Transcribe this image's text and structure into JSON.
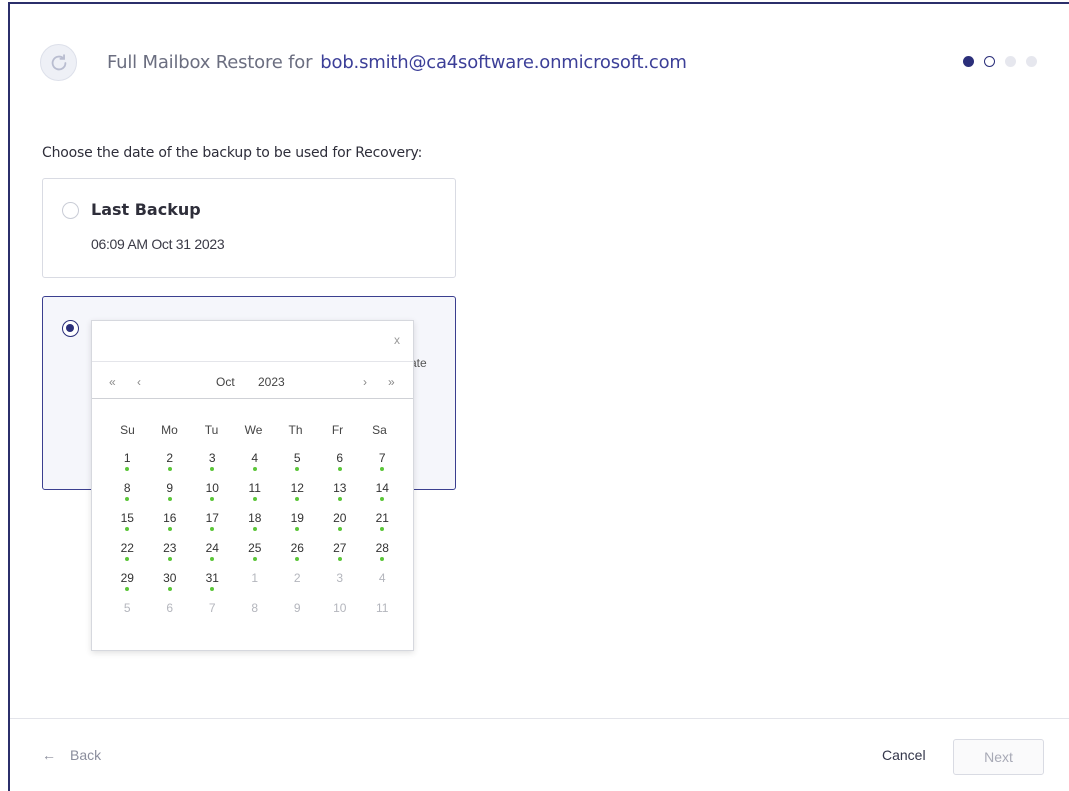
{
  "header": {
    "icon": "restore-icon",
    "title": "Full Mailbox Restore for",
    "email": "bob.smith@ca4software.onmicrosoft.com",
    "steps": [
      "active",
      "current",
      "pending",
      "pending"
    ]
  },
  "prompt": "Choose the date of the backup to be used for Recovery:",
  "options": {
    "last_backup": {
      "title": "Last Backup",
      "datetime": "06:09 AM Oct 31 2023",
      "selected": false
    },
    "custom_date": {
      "selected": true,
      "partial_text": "ate"
    }
  },
  "datepicker": {
    "close": "x",
    "prev_year": "«",
    "prev_month": "‹",
    "month": "Oct",
    "year": "2023",
    "next_month": "›",
    "next_year": "»",
    "weekdays": [
      "Su",
      "Mo",
      "Tu",
      "We",
      "Th",
      "Fr",
      "Sa"
    ],
    "days": [
      {
        "d": "1",
        "muted": false,
        "backup": true
      },
      {
        "d": "2",
        "muted": false,
        "backup": true
      },
      {
        "d": "3",
        "muted": false,
        "backup": true
      },
      {
        "d": "4",
        "muted": false,
        "backup": true
      },
      {
        "d": "5",
        "muted": false,
        "backup": true
      },
      {
        "d": "6",
        "muted": false,
        "backup": true
      },
      {
        "d": "7",
        "muted": false,
        "backup": true
      },
      {
        "d": "8",
        "muted": false,
        "backup": true
      },
      {
        "d": "9",
        "muted": false,
        "backup": true
      },
      {
        "d": "10",
        "muted": false,
        "backup": true
      },
      {
        "d": "11",
        "muted": false,
        "backup": true
      },
      {
        "d": "12",
        "muted": false,
        "backup": true
      },
      {
        "d": "13",
        "muted": false,
        "backup": true
      },
      {
        "d": "14",
        "muted": false,
        "backup": true
      },
      {
        "d": "15",
        "muted": false,
        "backup": true
      },
      {
        "d": "16",
        "muted": false,
        "backup": true
      },
      {
        "d": "17",
        "muted": false,
        "backup": true
      },
      {
        "d": "18",
        "muted": false,
        "backup": true
      },
      {
        "d": "19",
        "muted": false,
        "backup": true
      },
      {
        "d": "20",
        "muted": false,
        "backup": true
      },
      {
        "d": "21",
        "muted": false,
        "backup": true
      },
      {
        "d": "22",
        "muted": false,
        "backup": true
      },
      {
        "d": "23",
        "muted": false,
        "backup": true
      },
      {
        "d": "24",
        "muted": false,
        "backup": true
      },
      {
        "d": "25",
        "muted": false,
        "backup": true
      },
      {
        "d": "26",
        "muted": false,
        "backup": true
      },
      {
        "d": "27",
        "muted": false,
        "backup": true
      },
      {
        "d": "28",
        "muted": false,
        "backup": true
      },
      {
        "d": "29",
        "muted": false,
        "backup": true
      },
      {
        "d": "30",
        "muted": false,
        "backup": true
      },
      {
        "d": "31",
        "muted": false,
        "backup": true
      },
      {
        "d": "1",
        "muted": true,
        "backup": false
      },
      {
        "d": "2",
        "muted": true,
        "backup": false
      },
      {
        "d": "3",
        "muted": true,
        "backup": false
      },
      {
        "d": "4",
        "muted": true,
        "backup": false
      },
      {
        "d": "5",
        "muted": true,
        "backup": false
      },
      {
        "d": "6",
        "muted": true,
        "backup": false
      },
      {
        "d": "7",
        "muted": true,
        "backup": false
      },
      {
        "d": "8",
        "muted": true,
        "backup": false
      },
      {
        "d": "9",
        "muted": true,
        "backup": false
      },
      {
        "d": "10",
        "muted": true,
        "backup": false
      },
      {
        "d": "11",
        "muted": true,
        "backup": false
      }
    ]
  },
  "footer": {
    "back_arrow": "←",
    "back": "Back",
    "cancel": "Cancel",
    "next": "Next"
  },
  "colors": {
    "primary": "#2b2f7a",
    "email": "#3c3f98",
    "backup_dot": "#5cc63a"
  }
}
